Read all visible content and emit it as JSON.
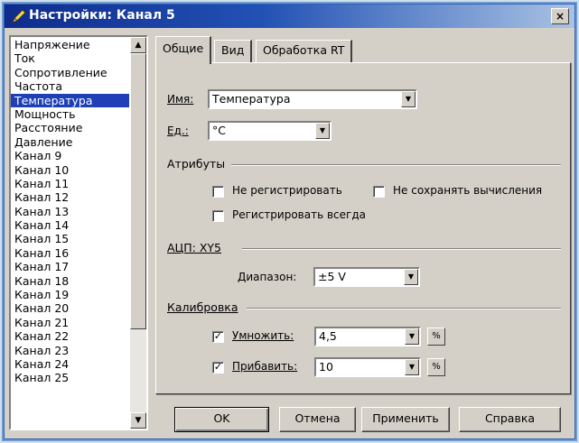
{
  "window": {
    "title": "Настройки: Канал 5",
    "close_label": "×"
  },
  "list": {
    "items": [
      "Напряжение",
      "Ток",
      "Сопротивление",
      "Частота",
      "Температура",
      "Мощность",
      "Расстояние",
      "Давление",
      "Канал 9",
      "Канал 10",
      "Канал 11",
      "Канал 12",
      "Канал 13",
      "Канал 14",
      "Канал 15",
      "Канал 16",
      "Канал 17",
      "Канал 18",
      "Канал 19",
      "Канал 20",
      "Канал 21",
      "Канал 22",
      "Канал 23",
      "Канал 24",
      "Канал 25"
    ],
    "selected": "Температура"
  },
  "tabs": [
    {
      "label": "Общие",
      "active": true
    },
    {
      "label": "Вид",
      "active": false
    },
    {
      "label": "Обработка RT",
      "active": false
    }
  ],
  "general": {
    "name_label": "Имя:",
    "name_value": "Температура",
    "unit_label": "Ед.:",
    "unit_value": "°C",
    "attributes": {
      "title": "Атрибуты",
      "no_register": {
        "label": "Не регистрировать",
        "checked": false
      },
      "no_save_calc": {
        "label": "Не сохранять вычисления",
        "checked": false
      },
      "always_register": {
        "label": "Регистрировать всегда",
        "checked": false
      }
    },
    "adc": {
      "title": "АЦП: XY5",
      "range_label": "Диапазон:",
      "range_value": "±5 V"
    },
    "calibration": {
      "title": "Калибровка",
      "multiply": {
        "label": "Умножить:",
        "checked": true,
        "value": "4,5"
      },
      "add": {
        "label": "Прибавить:",
        "checked": true,
        "value": "10"
      },
      "percent_icon": "%"
    }
  },
  "buttons": {
    "ok": "OK",
    "cancel": "Отмена",
    "apply": "Применить",
    "help": "Справка"
  },
  "glyphs": {
    "down": "▼",
    "up": "▲",
    "check": "✓"
  },
  "colors": {
    "selection": "#1e3fb6",
    "title_start": "#0f2c8c",
    "dialog": "#d4d0c8"
  }
}
